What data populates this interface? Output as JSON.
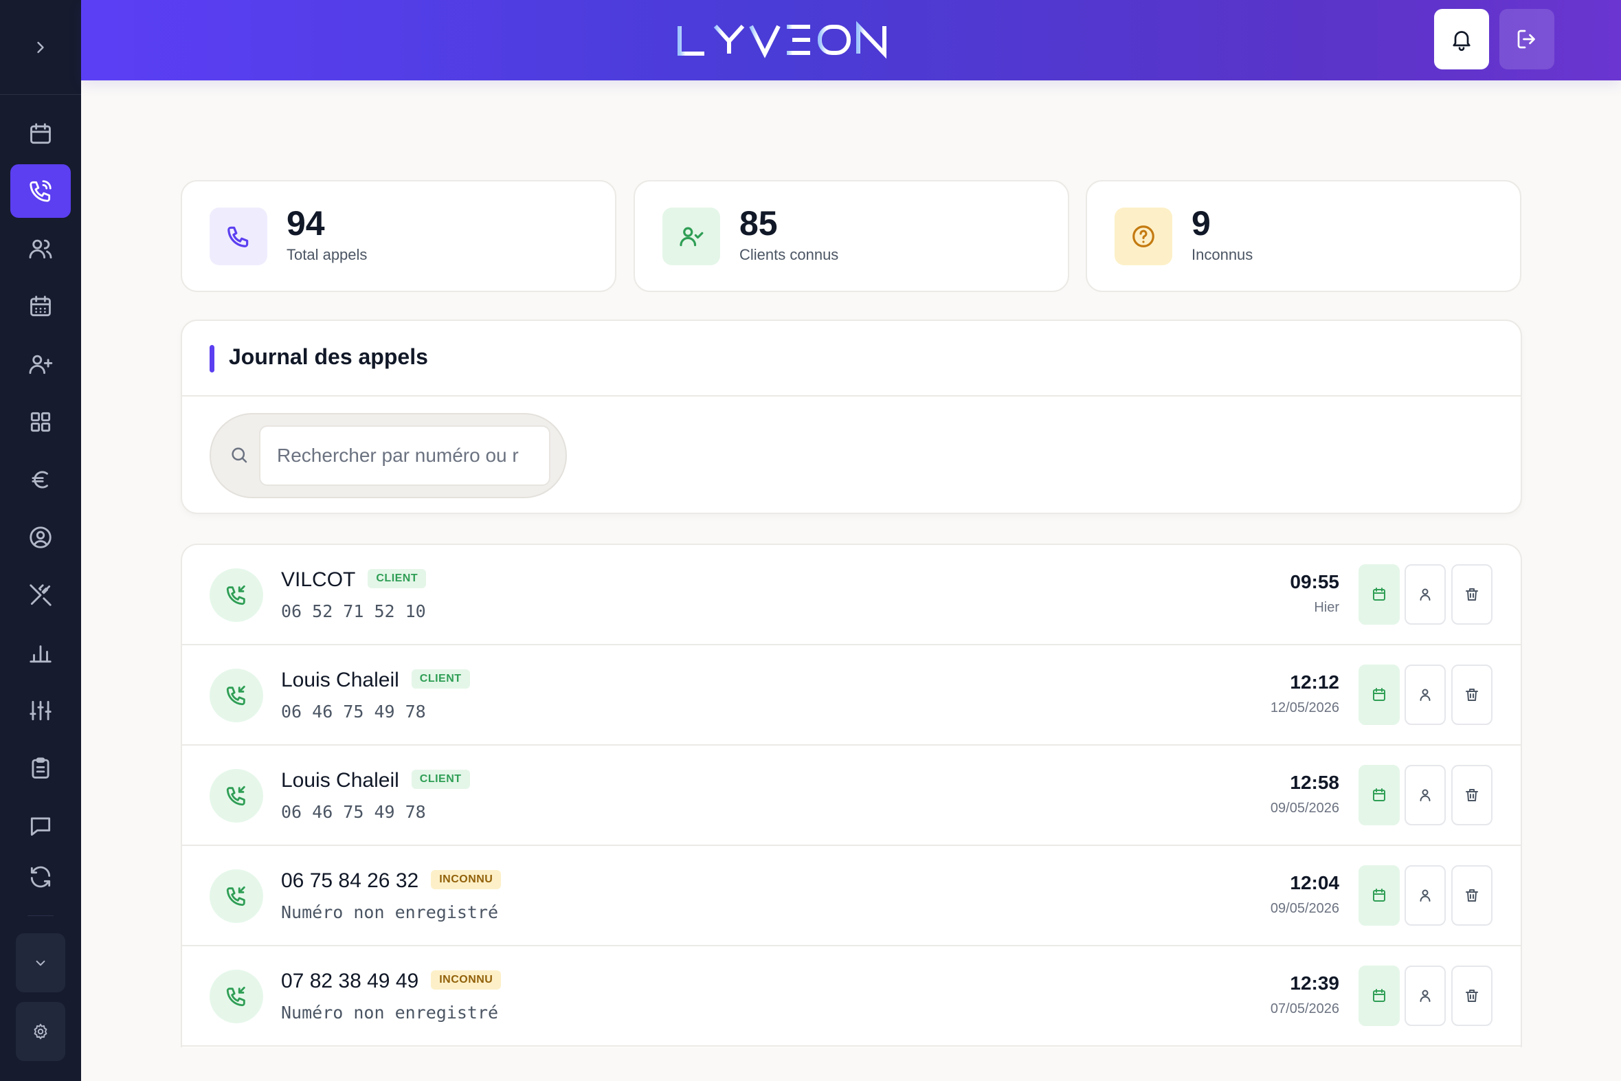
{
  "header": {
    "logo_text": "LYVEON",
    "notifications_label": "Notifications",
    "logout_label": "Déconnexion"
  },
  "sidebar": {
    "items": [
      {
        "icon": "calendar-icon"
      },
      {
        "icon": "phone-call-icon",
        "active": true
      },
      {
        "icon": "users-icon"
      },
      {
        "icon": "calendar-days-icon"
      },
      {
        "icon": "user-plus-icon"
      },
      {
        "icon": "grid-icon"
      },
      {
        "icon": "euro-icon"
      },
      {
        "icon": "user-circle-icon"
      },
      {
        "icon": "utensils-crossed-icon"
      },
      {
        "icon": "bar-chart-icon"
      },
      {
        "icon": "sliders-icon"
      },
      {
        "icon": "clipboard-icon"
      },
      {
        "icon": "message-icon"
      },
      {
        "icon": "refresh-icon"
      }
    ]
  },
  "stats": [
    {
      "value": "94",
      "label": "Total appels",
      "icon": "phone-icon",
      "color": "#5b3ff0",
      "bg": "#efedfd"
    },
    {
      "value": "85",
      "label": "Clients connus",
      "icon": "user-check-icon",
      "color": "#2f9e55",
      "bg": "#e4f6e8"
    },
    {
      "value": "9",
      "label": "Inconnus",
      "icon": "help-circle-icon",
      "color": "#c47a10",
      "bg": "#fdf0c8"
    }
  ],
  "journal": {
    "title": "Journal des appels",
    "search_placeholder": "Rechercher par numéro ou r"
  },
  "calls": [
    {
      "name": "VILCOT",
      "badge": "CLIENT",
      "badge_type": "client",
      "sub": "06 52 71 52 10",
      "time": "09:55",
      "date": "Hier"
    },
    {
      "name": "Louis Chaleil",
      "badge": "CLIENT",
      "badge_type": "client",
      "sub": "06 46 75 49 78",
      "time": "12:12",
      "date": "12/05/2026"
    },
    {
      "name": "Louis Chaleil",
      "badge": "CLIENT",
      "badge_type": "client",
      "sub": "06 46 75 49 78",
      "time": "12:58",
      "date": "09/05/2026"
    },
    {
      "name": "06 75 84 26 32",
      "badge": "INCONNU",
      "badge_type": "inconnu",
      "sub": "Numéro non enregistré",
      "time": "12:04",
      "date": "09/05/2026"
    },
    {
      "name": "07 82 38 49 49",
      "badge": "INCONNU",
      "badge_type": "inconnu",
      "sub": "Numéro non enregistré",
      "time": "12:39",
      "date": "07/05/2026"
    }
  ]
}
